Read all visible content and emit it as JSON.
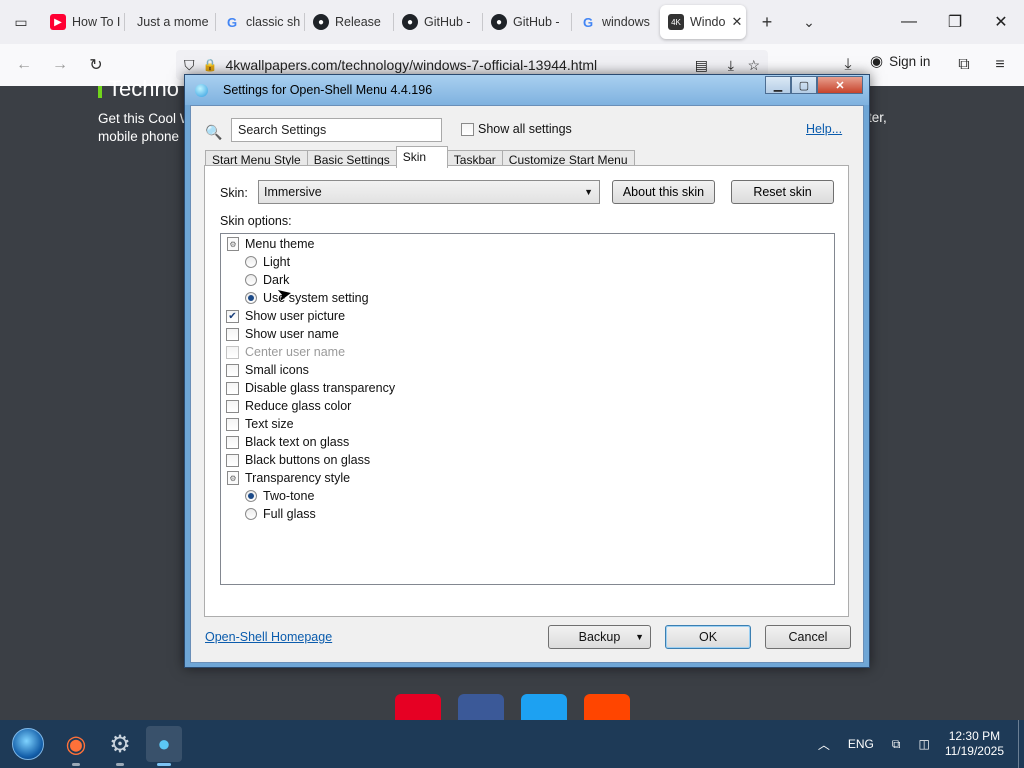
{
  "browser": {
    "tabs": [
      {
        "label": "How To I",
        "icon": "youtube-icon",
        "color": "#ff0033"
      },
      {
        "label": "Just a mome",
        "icon": "",
        "color": ""
      },
      {
        "label": "classic sh",
        "icon": "google-icon",
        "color": "#4285f4"
      },
      {
        "label": "Release",
        "icon": "github-icon",
        "color": "#1f2328"
      },
      {
        "label": "GitHub -",
        "icon": "github-icon",
        "color": "#1f2328"
      },
      {
        "label": "GitHub -",
        "icon": "github-icon",
        "color": "#1f2328"
      },
      {
        "label": "windows",
        "icon": "google-icon",
        "color": "#4285f4"
      }
    ],
    "active_tab": {
      "label": "Windo",
      "icon_text": "4K"
    },
    "url": "4kwallpapers.com/technology/windows-7-official-13944.html",
    "sign_in": "Sign in"
  },
  "page": {
    "heading_fragment": "Techno",
    "text_line1": "Get this Cool W",
    "text_line2": "mobile phone",
    "text_right": "ter,"
  },
  "dialog": {
    "title": "Settings for Open-Shell Menu 4.4.196",
    "search_placeholder": "Search Settings",
    "show_all_label": "Show all settings",
    "help_link": "Help...",
    "tabs": [
      "Start Menu Style",
      "Basic Settings",
      "Skin",
      "Taskbar",
      "Customize Start Menu"
    ],
    "selected_tab": "Skin",
    "skin_label": "Skin:",
    "skin_value": "Immersive",
    "about_skin": "About this skin",
    "reset_skin": "Reset skin",
    "skin_options_label": "Skin options:",
    "options": {
      "menu_theme": "Menu theme",
      "light": "Light",
      "dark": "Dark",
      "use_system": "Use system setting",
      "show_user_picture": "Show user picture",
      "show_user_name": "Show user name",
      "center_user_name": "Center user name",
      "small_icons": "Small icons",
      "disable_glass": "Disable glass transparency",
      "reduce_glass": "Reduce glass color",
      "text_size": "Text size",
      "black_text": "Black text on glass",
      "black_buttons": "Black buttons on glass",
      "transparency_style": "Transparency style",
      "two_tone": "Two-tone",
      "full_glass": "Full glass"
    },
    "homepage_link": "Open-Shell Homepage",
    "backup": "Backup",
    "ok": "OK",
    "cancel": "Cancel"
  },
  "taskbar": {
    "language": "ENG",
    "time": "12:30 PM",
    "date": "11/19/2025"
  }
}
